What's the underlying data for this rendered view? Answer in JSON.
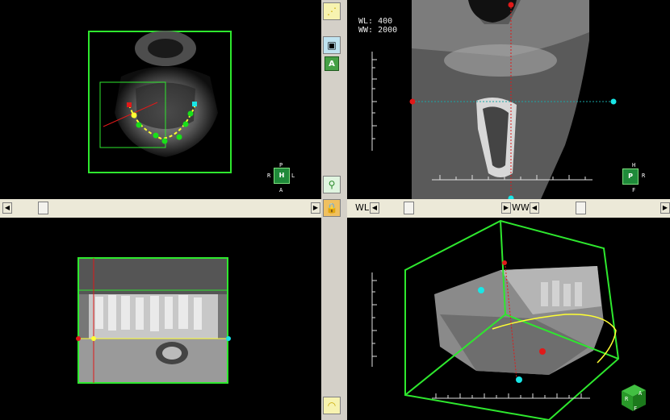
{
  "window_level": {
    "wl_text": "WL: 400",
    "ww_text": "WW: 2000"
  },
  "controls": {
    "wl_label": "WL",
    "ww_label": "WW"
  },
  "orientation_axial": {
    "top": "P",
    "center": "H",
    "bottom": "A",
    "left": "R",
    "right": "L"
  },
  "orientation_cross": {
    "top": "H",
    "center_left": "P",
    "center_right": "R",
    "bottom": "F"
  },
  "orientation_3d": {
    "front": "R",
    "side": "A",
    "bottom": "F"
  },
  "toolbar": {
    "icons": [
      "curve-tool-icon",
      "box-view-icon",
      "small-A-icon",
      "measure-icon",
      "lock-icon",
      "arc-icon"
    ]
  },
  "colors": {
    "frame_green": "#2ee82e",
    "panel_bg": "#000000",
    "curve_yellow": "#ffff33",
    "point_green": "#19e019",
    "point_red": "#e01919",
    "point_cyan": "#19e6e6",
    "ui_gray": "#d4d0c8"
  }
}
